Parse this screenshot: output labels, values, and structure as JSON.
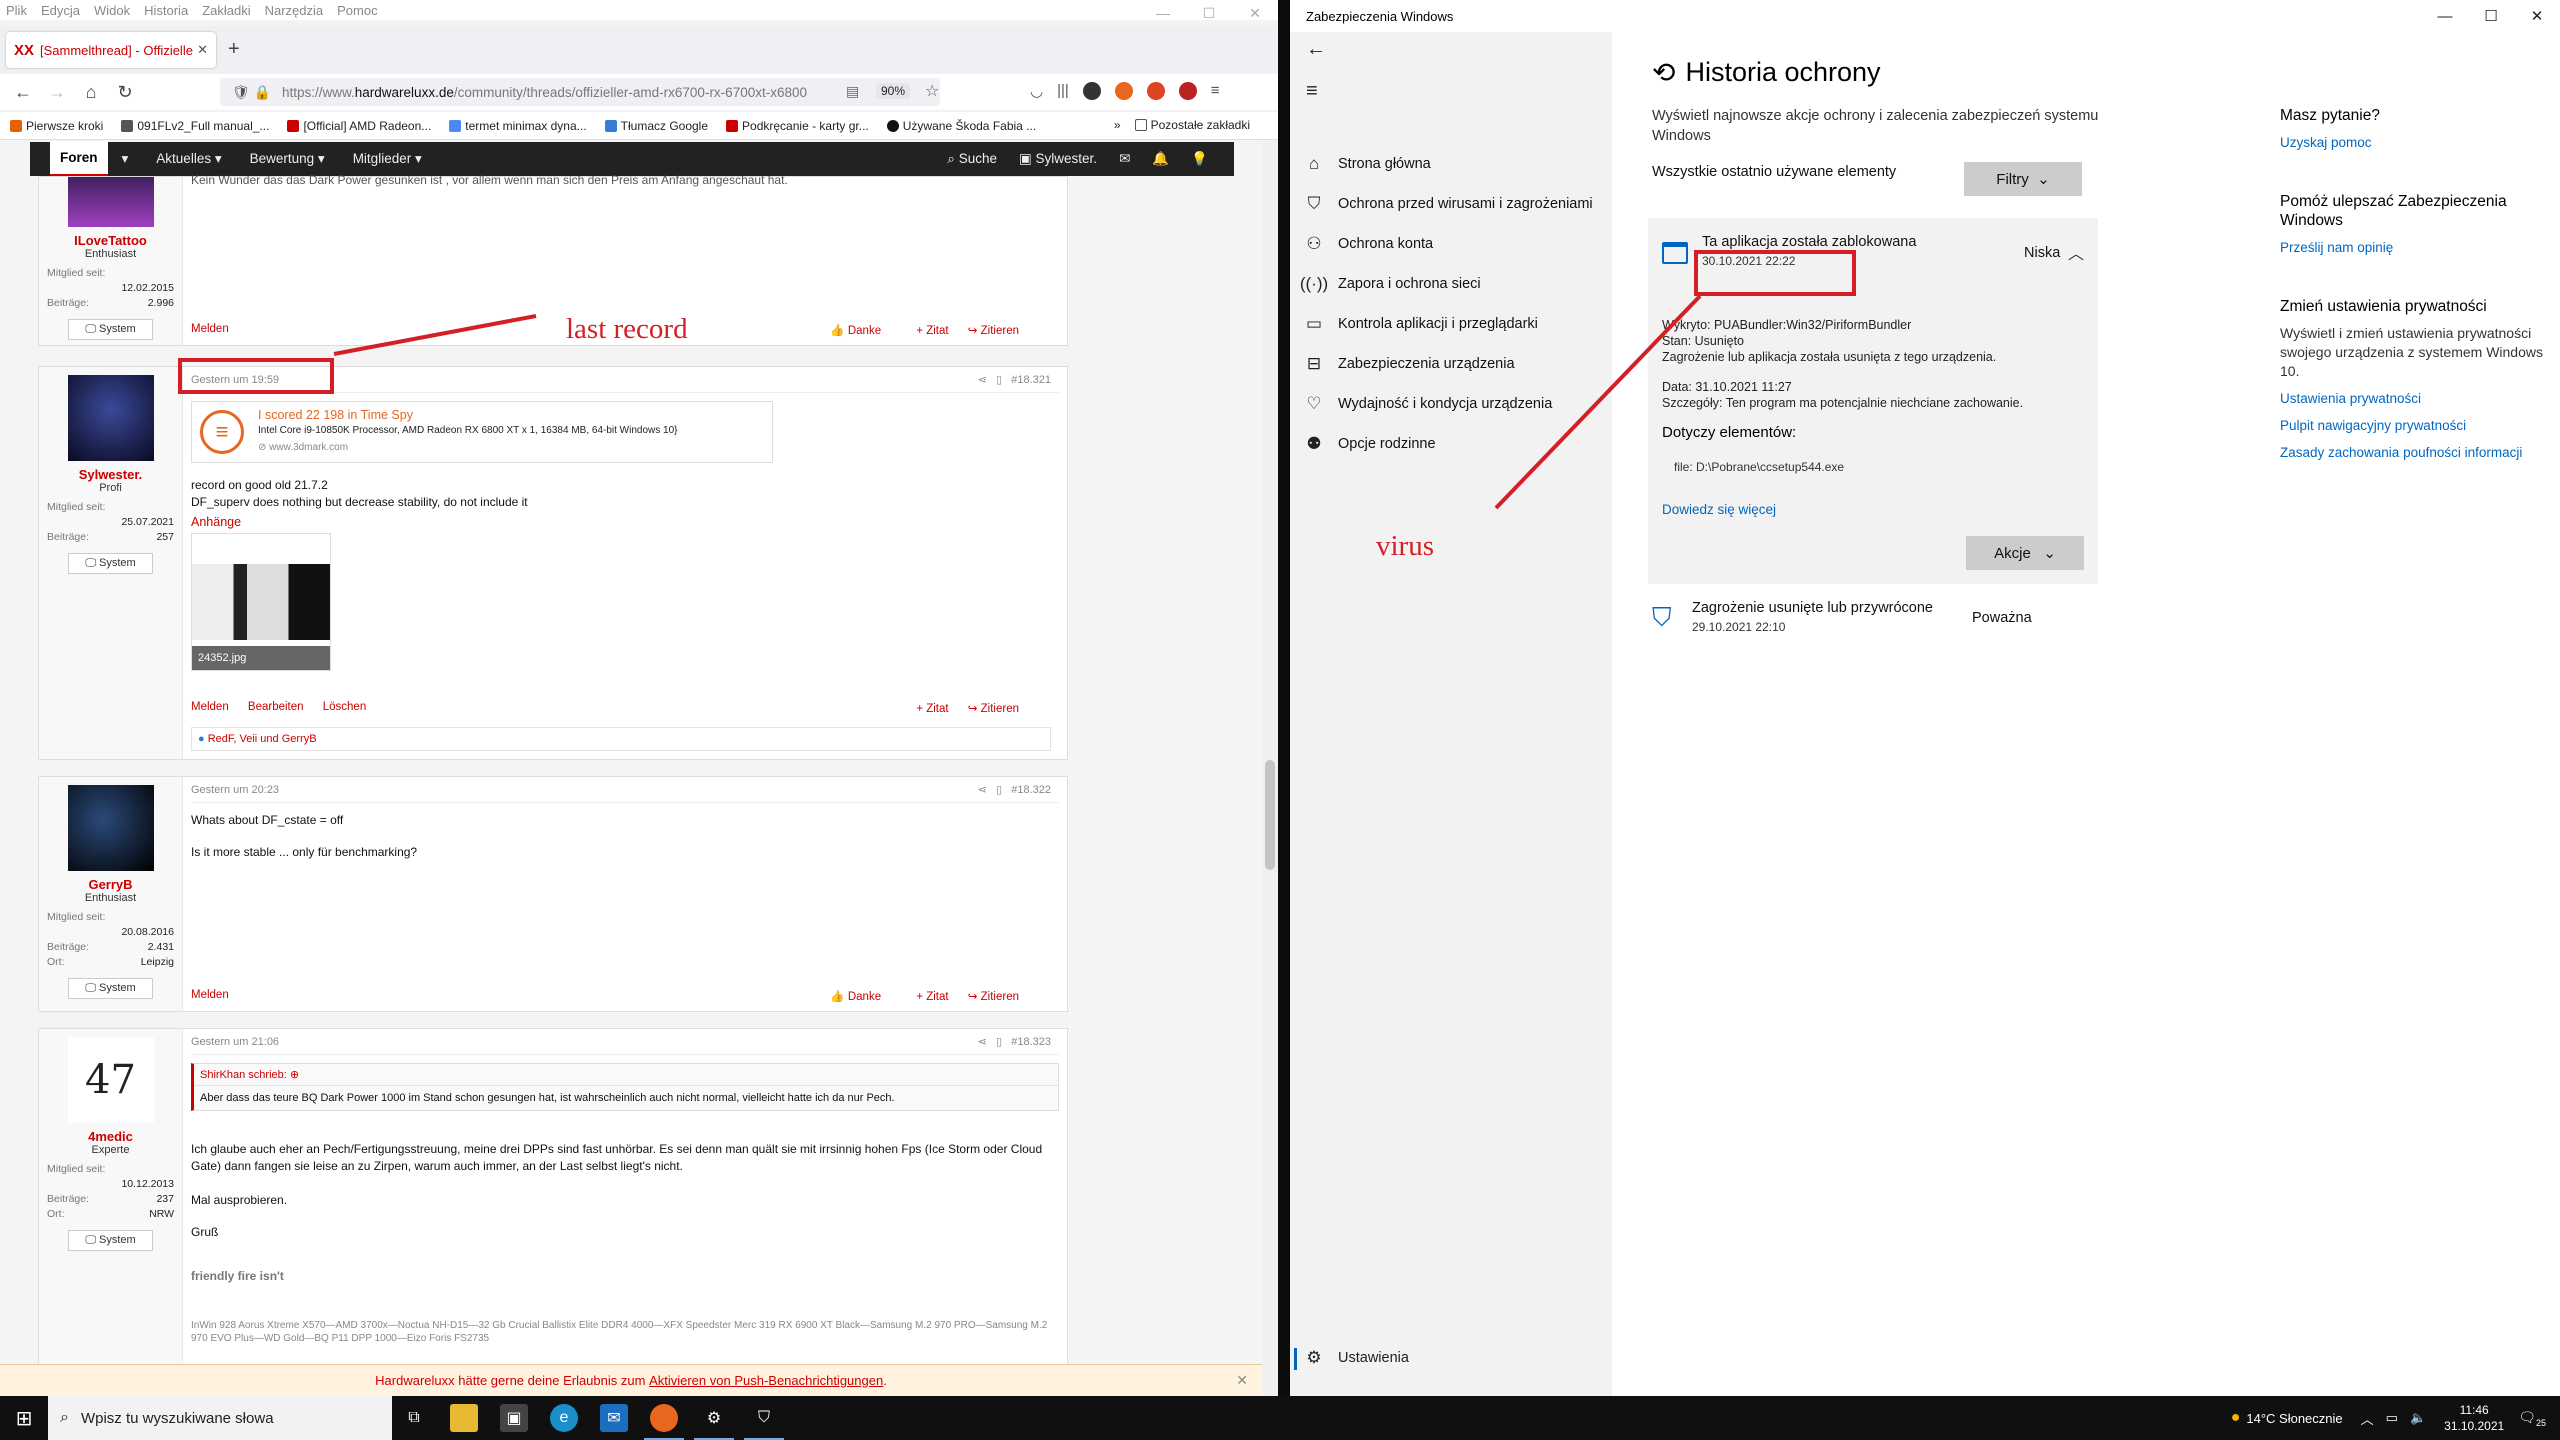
{
  "firefox": {
    "menu": [
      "Plik",
      "Edycja",
      "Widok",
      "Historia",
      "Zakładki",
      "Narzędzia",
      "Pomoc"
    ],
    "tab_title": "[Sammelthread] - Offizieller AM",
    "url_prefix": "https://www.",
    "url_host": "hardwareluxx.de",
    "url_path": "/community/threads/offizieller-amd-rx6700-rx-6700xt-x6800",
    "zoom": "90%",
    "bookmarks": [
      "Pierwsze kroki",
      "091FLv2_Full manual_...",
      "[Official] AMD Radeon...",
      "termet minimax dyna...",
      "Tłumacz Google",
      "Podkręcanie - karty gr...",
      "Używane Škoda Fabia ..."
    ],
    "bookmarks_other": "Pozostałe zakładki"
  },
  "forum": {
    "nav": [
      "Foren",
      "Aktuelles",
      "Bewertung",
      "Mitglieder"
    ],
    "search": "Suche",
    "user": "Sylwester.",
    "posts": [
      {
        "top_text": "Kein Wunder das das Dark Power gesunken ist , vor allem wenn man sich den Preis am Anfang angeschaut hat.",
        "user": "ILoveTattoo",
        "role": "Enthusiast",
        "stats": [
          [
            "Mitglied seit:",
            "12.02.2015"
          ],
          [
            "Beiträge:",
            "2.996"
          ]
        ],
        "sys": "System",
        "footer_left": [
          "Melden"
        ],
        "footer_right": [
          "Danke",
          "+ Zitat",
          "Zitieren"
        ]
      },
      {
        "time": "Gestern um 19:59",
        "num": "#18.321",
        "user": "Sylwester.",
        "role": "Profi",
        "stats": [
          [
            "Mitglied seit:",
            "25.07.2021"
          ],
          [
            "Beiträge:",
            "257"
          ]
        ],
        "sys": "System",
        "embed_title": "I scored 22 198 in Time Spy",
        "embed_desc": "Intel Core i9-10850K Processor, AMD Radeon RX 6800 XT x 1, 16384 MB, 64-bit Windows 10}",
        "embed_site": "www.3dmark.com",
        "lines": [
          "record on good old 21.7.2",
          "DF_superv does nothing but decrease stability, do not include it"
        ],
        "attachments": "Anhänge",
        "attachment_name": "24352.jpg",
        "footer_left": [
          "Melden",
          "Bearbeiten",
          "Löschen"
        ],
        "footer_right": [
          "+ Zitat",
          "Zitieren"
        ],
        "reactions": "RedF, Veii und GerryB"
      },
      {
        "time": "Gestern um 20:23",
        "num": "#18.322",
        "user": "GerryB",
        "role": "Enthusiast",
        "stats": [
          [
            "Mitglied seit:",
            "20.08.2016"
          ],
          [
            "Beiträge:",
            "2.431"
          ],
          [
            "Ort:",
            "Leipzig"
          ]
        ],
        "sys": "System",
        "lines": [
          "Whats about DF_cstate = off",
          "Is it more stable ... only für benchmarking?"
        ],
        "footer_left": [
          "Melden"
        ],
        "footer_right": [
          "Danke",
          "+ Zitat",
          "Zitieren"
        ]
      },
      {
        "time": "Gestern um 21:06",
        "num": "#18.323",
        "user": "4medic",
        "role": "Experte",
        "avatar_text": "47",
        "stats": [
          [
            "Mitglied seit:",
            "10.12.2013"
          ],
          [
            "Beiträge:",
            "237"
          ],
          [
            "Ort:",
            "NRW"
          ]
        ],
        "sys": "System",
        "quote_head": "ShirKhan schrieb:",
        "quote_body": "Aber dass das teure BQ Dark Power 1000 im Stand schon gesungen hat, ist wahrscheinlich auch nicht normal, vielleicht hatte ich da nur Pech.",
        "lines": [
          "Ich glaube auch eher an Pech/Fertigungsstreuung, meine drei DPPs sind fast unhörbar. Es sei denn man quält sie mit irrsinnig hohen Fps (Ice Storm oder Cloud Gate) dann fangen sie leise an zu Zirpen, warum auch immer, an der Last selbst liegt's nicht.",
          "Mal ausprobieren.",
          "Gruß"
        ],
        "sig1": "friendly fire isn't",
        "sig2": "InWin 928 Aorus Xtreme X570—AMD 3700x—Noctua NH-D15—32 Gb Crucial Ballistix Elite DDR4 4000—XFX Speedster Merc 319 RX 6900 XT Black—Samsung M.2 970 PRO—Samsung M.2 970 EVO Plus—WD Gold—BQ P11 DPP 1000—Eizo Foris FS2735"
      }
    ],
    "cookie_text": "Hardwareluxx hätte gerne deine Erlaubnis zum ",
    "cookie_link": "Aktivieren von Push-Benachrichtigungen",
    "cookie_end": "."
  },
  "annotations": {
    "last_record": "last record",
    "virus": "virus"
  },
  "security": {
    "window_title": "Zabezpieczenia Windows",
    "nav": [
      "Strona główna",
      "Ochrona przed wirusami i zagrożeniami",
      "Ochrona konta",
      "Zapora i ochrona sieci",
      "Kontrola aplikacji i przeglądarki",
      "Zabezpieczenia urządzenia",
      "Wydajność i kondycja urządzenia",
      "Opcje rodzinne"
    ],
    "settings": "Ustawienia",
    "heading": "Historia ochrony",
    "description": "Wyświetl najnowsze akcje ochrony i zalecenia zabezpieczeń systemu Windows",
    "filter_label": "Wszystkie ostatnio używane elementy",
    "filter_button": "Filtry",
    "card": {
      "title": "Ta aplikacja została zablokowana",
      "date": "30.10.2021 22:22",
      "severity": "Niska",
      "detected": "Wykryto: PUABundler:Win32/PiriformBundler",
      "state": "Stan: Usunięto",
      "info": "Zagrożenie lub aplikacja została usunięta z tego urządzenia.",
      "date2": "Data: 31.10.2021 11:27",
      "details": "Szczegóły:  Ten program ma potencjalnie niechciane zachowanie.",
      "affected_label": "Dotyczy elementów:",
      "file": "file: D:\\Pobrane\\ccsetup544.exe",
      "learn_more": "Dowiedz się więcej",
      "actions": "Akcje"
    },
    "item2": {
      "title": "Zagrożenie usunięte lub przywrócone",
      "date": "29.10.2021 22:10",
      "severity": "Poważna"
    },
    "right": {
      "q_head": "Masz pytanie?",
      "q_link": "Uzyskaj pomoc",
      "improve_head": "Pomóż ulepszać Zabezpieczenia Windows",
      "improve_link": "Prześlij nam opinię",
      "privacy_head": "Zmień ustawienia prywatności",
      "privacy_text": "Wyświetl i zmień ustawienia prywatności swojego urządzenia z systemem Windows 10.",
      "links": [
        "Ustawienia prywatności",
        "Pulpit nawigacyjny prywatności",
        "Zasady zachowania poufności informacji"
      ]
    }
  },
  "taskbar": {
    "search_placeholder": "Wpisz tu wyszukiwane słowa",
    "weather": "14°C  Słonecznie",
    "time": "11:46",
    "date": "31.10.2021",
    "notif_count": "25"
  }
}
